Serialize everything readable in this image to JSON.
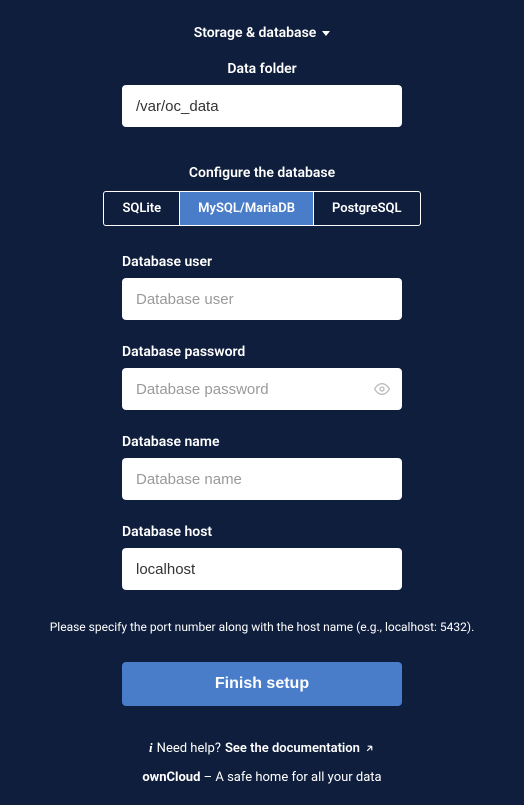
{
  "toggle": {
    "label": "Storage & database"
  },
  "data_folder": {
    "label": "Data folder",
    "value": "/var/oc_data"
  },
  "db_section": {
    "label": "Configure the database",
    "tabs": [
      {
        "label": "SQLite",
        "active": false
      },
      {
        "label": "MySQL/MariaDB",
        "active": true
      },
      {
        "label": "PostgreSQL",
        "active": false
      }
    ]
  },
  "db_user": {
    "label": "Database user",
    "placeholder": "Database user",
    "value": ""
  },
  "db_password": {
    "label": "Database password",
    "placeholder": "Database password",
    "value": ""
  },
  "db_name": {
    "label": "Database name",
    "placeholder": "Database name",
    "value": ""
  },
  "db_host": {
    "label": "Database host",
    "value": "localhost"
  },
  "hint": "Please specify the port number along with the host name (e.g., localhost: 5432).",
  "finish_label": "Finish setup",
  "help": {
    "prefix": "Need help?",
    "link_text": "See the documentation"
  },
  "footer": {
    "brand": "ownCloud",
    "tagline": " – A safe home for all your data"
  }
}
